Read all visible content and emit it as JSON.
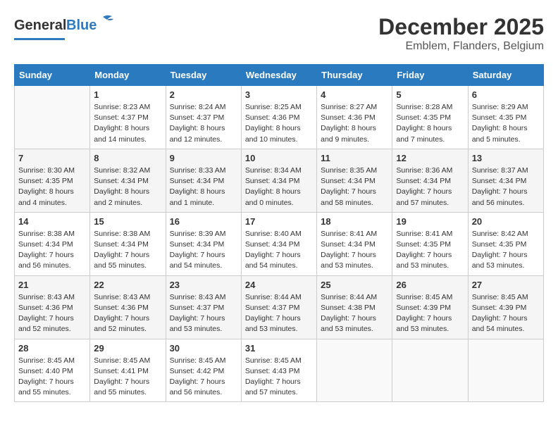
{
  "header": {
    "logo_general": "General",
    "logo_blue": "Blue",
    "month_year": "December 2025",
    "location": "Emblem, Flanders, Belgium"
  },
  "days_of_week": [
    "Sunday",
    "Monday",
    "Tuesday",
    "Wednesday",
    "Thursday",
    "Friday",
    "Saturday"
  ],
  "weeks": [
    [
      {
        "day": "",
        "info": ""
      },
      {
        "day": "1",
        "info": "Sunrise: 8:23 AM\nSunset: 4:37 PM\nDaylight: 8 hours\nand 14 minutes."
      },
      {
        "day": "2",
        "info": "Sunrise: 8:24 AM\nSunset: 4:37 PM\nDaylight: 8 hours\nand 12 minutes."
      },
      {
        "day": "3",
        "info": "Sunrise: 8:25 AM\nSunset: 4:36 PM\nDaylight: 8 hours\nand 10 minutes."
      },
      {
        "day": "4",
        "info": "Sunrise: 8:27 AM\nSunset: 4:36 PM\nDaylight: 8 hours\nand 9 minutes."
      },
      {
        "day": "5",
        "info": "Sunrise: 8:28 AM\nSunset: 4:35 PM\nDaylight: 8 hours\nand 7 minutes."
      },
      {
        "day": "6",
        "info": "Sunrise: 8:29 AM\nSunset: 4:35 PM\nDaylight: 8 hours\nand 5 minutes."
      }
    ],
    [
      {
        "day": "7",
        "info": "Sunrise: 8:30 AM\nSunset: 4:35 PM\nDaylight: 8 hours\nand 4 minutes."
      },
      {
        "day": "8",
        "info": "Sunrise: 8:32 AM\nSunset: 4:34 PM\nDaylight: 8 hours\nand 2 minutes."
      },
      {
        "day": "9",
        "info": "Sunrise: 8:33 AM\nSunset: 4:34 PM\nDaylight: 8 hours\nand 1 minute."
      },
      {
        "day": "10",
        "info": "Sunrise: 8:34 AM\nSunset: 4:34 PM\nDaylight: 8 hours\nand 0 minutes."
      },
      {
        "day": "11",
        "info": "Sunrise: 8:35 AM\nSunset: 4:34 PM\nDaylight: 7 hours\nand 58 minutes."
      },
      {
        "day": "12",
        "info": "Sunrise: 8:36 AM\nSunset: 4:34 PM\nDaylight: 7 hours\nand 57 minutes."
      },
      {
        "day": "13",
        "info": "Sunrise: 8:37 AM\nSunset: 4:34 PM\nDaylight: 7 hours\nand 56 minutes."
      }
    ],
    [
      {
        "day": "14",
        "info": "Sunrise: 8:38 AM\nSunset: 4:34 PM\nDaylight: 7 hours\nand 56 minutes."
      },
      {
        "day": "15",
        "info": "Sunrise: 8:38 AM\nSunset: 4:34 PM\nDaylight: 7 hours\nand 55 minutes."
      },
      {
        "day": "16",
        "info": "Sunrise: 8:39 AM\nSunset: 4:34 PM\nDaylight: 7 hours\nand 54 minutes."
      },
      {
        "day": "17",
        "info": "Sunrise: 8:40 AM\nSunset: 4:34 PM\nDaylight: 7 hours\nand 54 minutes."
      },
      {
        "day": "18",
        "info": "Sunrise: 8:41 AM\nSunset: 4:34 PM\nDaylight: 7 hours\nand 53 minutes."
      },
      {
        "day": "19",
        "info": "Sunrise: 8:41 AM\nSunset: 4:35 PM\nDaylight: 7 hours\nand 53 minutes."
      },
      {
        "day": "20",
        "info": "Sunrise: 8:42 AM\nSunset: 4:35 PM\nDaylight: 7 hours\nand 53 minutes."
      }
    ],
    [
      {
        "day": "21",
        "info": "Sunrise: 8:43 AM\nSunset: 4:36 PM\nDaylight: 7 hours\nand 52 minutes."
      },
      {
        "day": "22",
        "info": "Sunrise: 8:43 AM\nSunset: 4:36 PM\nDaylight: 7 hours\nand 52 minutes."
      },
      {
        "day": "23",
        "info": "Sunrise: 8:43 AM\nSunset: 4:37 PM\nDaylight: 7 hours\nand 53 minutes."
      },
      {
        "day": "24",
        "info": "Sunrise: 8:44 AM\nSunset: 4:37 PM\nDaylight: 7 hours\nand 53 minutes."
      },
      {
        "day": "25",
        "info": "Sunrise: 8:44 AM\nSunset: 4:38 PM\nDaylight: 7 hours\nand 53 minutes."
      },
      {
        "day": "26",
        "info": "Sunrise: 8:45 AM\nSunset: 4:39 PM\nDaylight: 7 hours\nand 53 minutes."
      },
      {
        "day": "27",
        "info": "Sunrise: 8:45 AM\nSunset: 4:39 PM\nDaylight: 7 hours\nand 54 minutes."
      }
    ],
    [
      {
        "day": "28",
        "info": "Sunrise: 8:45 AM\nSunset: 4:40 PM\nDaylight: 7 hours\nand 55 minutes."
      },
      {
        "day": "29",
        "info": "Sunrise: 8:45 AM\nSunset: 4:41 PM\nDaylight: 7 hours\nand 55 minutes."
      },
      {
        "day": "30",
        "info": "Sunrise: 8:45 AM\nSunset: 4:42 PM\nDaylight: 7 hours\nand 56 minutes."
      },
      {
        "day": "31",
        "info": "Sunrise: 8:45 AM\nSunset: 4:43 PM\nDaylight: 7 hours\nand 57 minutes."
      },
      {
        "day": "",
        "info": ""
      },
      {
        "day": "",
        "info": ""
      },
      {
        "day": "",
        "info": ""
      }
    ]
  ]
}
